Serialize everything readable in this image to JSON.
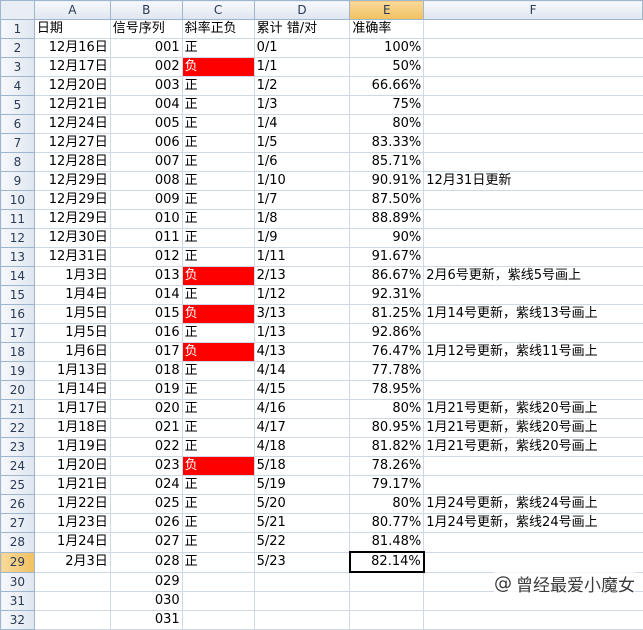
{
  "columns": [
    "A",
    "B",
    "C",
    "D",
    "E",
    "F"
  ],
  "header_row": {
    "A": "日期",
    "B": "信号序列",
    "C": "斜率正负",
    "D": "累计 错/对",
    "E": "准确率",
    "F": ""
  },
  "rows": [
    {
      "n": "2",
      "A": "12月16日",
      "B": "001",
      "C": "正",
      "D": "0/1",
      "E": "100%",
      "F": ""
    },
    {
      "n": "3",
      "A": "12月17日",
      "B": "002",
      "C": "负",
      "D": "1/1",
      "E": "50%",
      "F": ""
    },
    {
      "n": "4",
      "A": "12月20日",
      "B": "003",
      "C": "正",
      "D": "1/2",
      "E": "66.66%",
      "F": ""
    },
    {
      "n": "5",
      "A": "12月21日",
      "B": "004",
      "C": "正",
      "D": "1/3",
      "E": "75%",
      "F": ""
    },
    {
      "n": "6",
      "A": "12月24日",
      "B": "005",
      "C": "正",
      "D": "1/4",
      "E": "80%",
      "F": ""
    },
    {
      "n": "7",
      "A": "12月27日",
      "B": "006",
      "C": "正",
      "D": "1/5",
      "E": "83.33%",
      "F": ""
    },
    {
      "n": "8",
      "A": "12月28日",
      "B": "007",
      "C": "正",
      "D": "1/6",
      "E": "85.71%",
      "F": ""
    },
    {
      "n": "9",
      "A": "12月29日",
      "B": "008",
      "C": "正",
      "D": "1/10",
      "E": "90.91%",
      "F": "12月31日更新"
    },
    {
      "n": "10",
      "A": "12月29日",
      "B": "009",
      "C": "正",
      "D": "1/7",
      "E": "87.50%",
      "F": ""
    },
    {
      "n": "11",
      "A": "12月29日",
      "B": "010",
      "C": "正",
      "D": "1/8",
      "E": "88.89%",
      "F": ""
    },
    {
      "n": "12",
      "A": "12月30日",
      "B": "011",
      "C": "正",
      "D": "1/9",
      "E": "90%",
      "F": ""
    },
    {
      "n": "13",
      "A": "12月31日",
      "B": "012",
      "C": "正",
      "D": "1/11",
      "E": "91.67%",
      "F": ""
    },
    {
      "n": "14",
      "A": "1月3日",
      "B": "013",
      "C": "负",
      "D": "2/13",
      "E": "86.67%",
      "F": "2月6号更新，紫线5号画上"
    },
    {
      "n": "15",
      "A": "1月4日",
      "B": "014",
      "C": "正",
      "D": "1/12",
      "E": "92.31%",
      "F": ""
    },
    {
      "n": "16",
      "A": "1月5日",
      "B": "015",
      "C": "负",
      "D": "3/13",
      "E": "81.25%",
      "F": "1月14号更新，紫线13号画上"
    },
    {
      "n": "17",
      "A": "1月5日",
      "B": "016",
      "C": "正",
      "D": "1/13",
      "E": "92.86%",
      "F": ""
    },
    {
      "n": "18",
      "A": "1月6日",
      "B": "017",
      "C": "负",
      "D": "4/13",
      "E": "76.47%",
      "F": "1月12号更新，紫线11号画上"
    },
    {
      "n": "19",
      "A": "1月13日",
      "B": "018",
      "C": "正",
      "D": "4/14",
      "E": "77.78%",
      "F": ""
    },
    {
      "n": "20",
      "A": "1月14日",
      "B": "019",
      "C": "正",
      "D": "4/15",
      "E": "78.95%",
      "F": ""
    },
    {
      "n": "21",
      "A": "1月17日",
      "B": "020",
      "C": "正",
      "D": "4/16",
      "E": "80%",
      "F": "1月21号更新，紫线20号画上"
    },
    {
      "n": "22",
      "A": "1月18日",
      "B": "021",
      "C": "正",
      "D": "4/17",
      "E": "80.95%",
      "F": "1月21号更新，紫线20号画上"
    },
    {
      "n": "23",
      "A": "1月19日",
      "B": "022",
      "C": "正",
      "D": "4/18",
      "E": "81.82%",
      "F": "1月21号更新，紫线20号画上"
    },
    {
      "n": "24",
      "A": "1月20日",
      "B": "023",
      "C": "负",
      "D": "5/18",
      "E": "78.26%",
      "F": ""
    },
    {
      "n": "25",
      "A": "1月21日",
      "B": "024",
      "C": "正",
      "D": "5/19",
      "E": "79.17%",
      "F": ""
    },
    {
      "n": "26",
      "A": "1月22日",
      "B": "025",
      "C": "正",
      "D": "5/20",
      "E": "80%",
      "F": "1月24号更新，紫线24号画上"
    },
    {
      "n": "27",
      "A": "1月23日",
      "B": "026",
      "C": "正",
      "D": "5/21",
      "E": "80.77%",
      "F": "1月24号更新，紫线24号画上"
    },
    {
      "n": "28",
      "A": "1月24日",
      "B": "027",
      "C": "正",
      "D": "5/22",
      "E": "81.48%",
      "F": ""
    },
    {
      "n": "29",
      "A": "2月3日",
      "B": "028",
      "C": "正",
      "D": "5/23",
      "E": "82.14%",
      "F": ""
    },
    {
      "n": "30",
      "A": "",
      "B": "029",
      "C": "",
      "D": "",
      "E": "",
      "F": ""
    },
    {
      "n": "31",
      "A": "",
      "B": "030",
      "C": "",
      "D": "",
      "E": "",
      "F": ""
    },
    {
      "n": "32",
      "A": "",
      "B": "031",
      "C": "",
      "D": "",
      "E": "",
      "F": ""
    }
  ],
  "selected_cell": "E29",
  "negative_fill_color": "#ff0000",
  "watermark": {
    "icon": "at-sign-icon",
    "text": "曾经最爱小魔女"
  }
}
